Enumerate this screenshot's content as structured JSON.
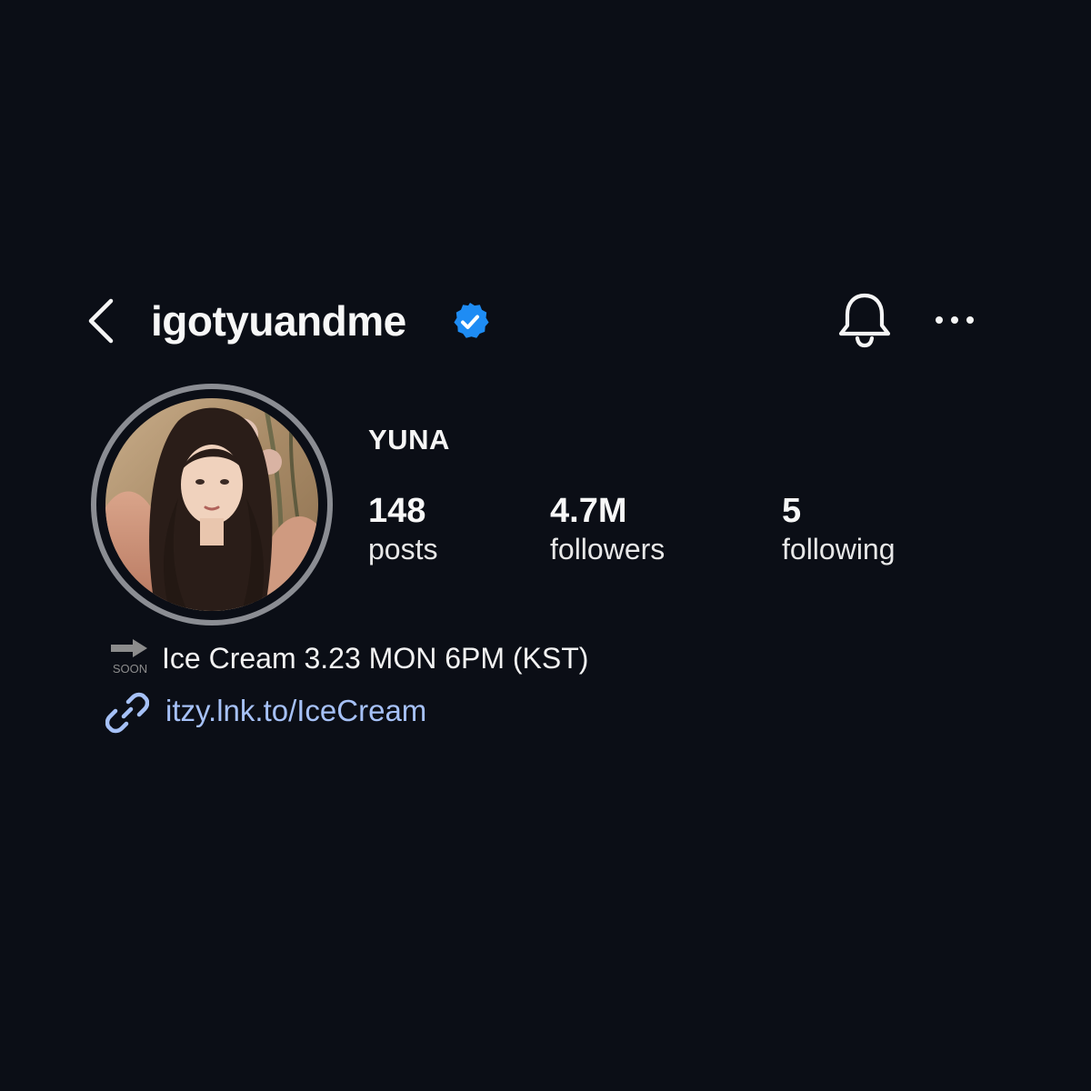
{
  "header": {
    "username": "igotyuandme",
    "verified": true
  },
  "profile": {
    "display_name": "YUNA",
    "stats": [
      {
        "value": "148",
        "label": "posts"
      },
      {
        "value": "4.7M",
        "label": "followers"
      },
      {
        "value": "5",
        "label": "following"
      }
    ]
  },
  "bio": {
    "soon_badge": "SOON",
    "line": "Ice Cream 3.23 MON 6PM (KST)",
    "link": "itzy.lnk.to/IceCream"
  },
  "icons": {
    "back": "chevron-left-icon",
    "verified": "verified-badge-icon",
    "bell": "bell-icon",
    "more": "more-horizontal-icon",
    "soon": "soon-arrow-icon",
    "link": "link-icon"
  },
  "colors": {
    "background": "#0b0e16",
    "verified_blue": "#1e8cf4",
    "link_blue": "#a6c1f7",
    "avatar_ring": "#8b8d93"
  }
}
